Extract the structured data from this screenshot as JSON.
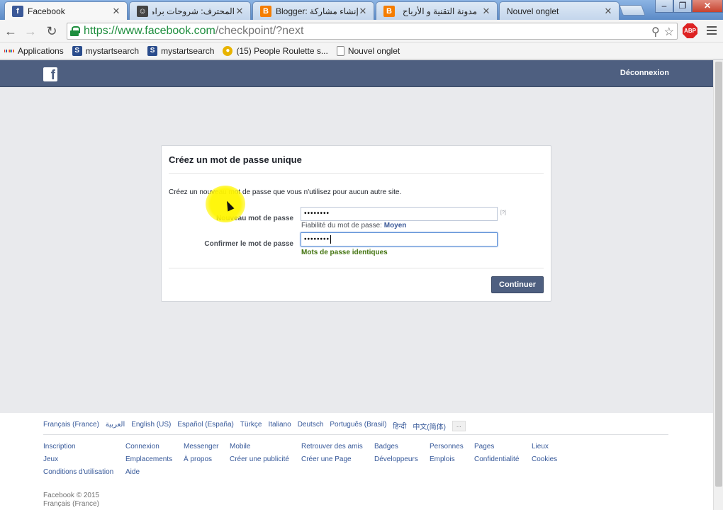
{
  "browser": {
    "tabs": [
      {
        "title": "Facebook",
        "icon": "facebook-icon",
        "color": "#3b5998",
        "active": true
      },
      {
        "title": "المحترف: شروحات برامج",
        "icon": "avatar-icon",
        "color": "#444444",
        "active": false
      },
      {
        "title": "Blogger: إنشاء مشاركة -",
        "icon": "blogger-icon",
        "color": "#f57d00",
        "active": false
      },
      {
        "title": "مدونة التقنية و الأرباح",
        "icon": "blogger-icon",
        "color": "#f57d00",
        "active": false
      },
      {
        "title": "Nouvel onglet",
        "icon": "none",
        "color": "#ffffff",
        "active": false
      }
    ],
    "window_controls": [
      "–",
      "❐",
      "✕"
    ],
    "url": {
      "secure_part": "https://www.facebook.com",
      "rest": "/checkpoint/?next"
    },
    "adblock_label": "ABP",
    "bookmarks": [
      {
        "label": "Applications",
        "icon": "apps-grid-icon"
      },
      {
        "label": "mystartsearch",
        "icon": "mystartsearch-icon"
      },
      {
        "label": "mystartsearch",
        "icon": "mystartsearch-icon"
      },
      {
        "label": "(15) People Roulette s...",
        "icon": "roulette-icon"
      },
      {
        "label": "Nouvel onglet",
        "icon": "page-icon"
      }
    ]
  },
  "header": {
    "logout_label": "Déconnexion"
  },
  "card": {
    "title": "Créez un mot de passe unique",
    "description": "Créez un nouveau mot de passe que vous n'utilisez pour aucun autre site.",
    "new_password_label": "Nouveau mot de passe",
    "new_password_value": "••••••••",
    "help_link": "[?]",
    "strength_prefix": "Fiabilité du mot de passe:",
    "strength_value": "Moyen",
    "confirm_label": "Confirmer le mot de passe",
    "confirm_value": "••••••••",
    "match_text": "Mots de passe identiques",
    "continue_label": "Continuer"
  },
  "footer": {
    "languages": [
      "Français (France)",
      "العربية",
      "English (US)",
      "Español (España)",
      "Türkçe",
      "Italiano",
      "Deutsch",
      "Português (Brasil)",
      "हिन्दी",
      "中文(简体)"
    ],
    "more_languages": "...",
    "links": {
      "col1": [
        "Inscription",
        "Jeux",
        "Conditions d'utilisation"
      ],
      "col2": [
        "Connexion",
        "Emplacements",
        "Aide"
      ],
      "col3": [
        "Messenger",
        "À propos"
      ],
      "col4": [
        "Mobile",
        "Créer une publicité"
      ],
      "col5": [
        "Retrouver des amis",
        "Créer une Page"
      ],
      "col6": [
        "Badges",
        "Développeurs"
      ],
      "col7": [
        "Personnes",
        "Emplois"
      ],
      "col8": [
        "Pages",
        "Confidentialité"
      ],
      "col9": [
        "Lieux",
        "Cookies"
      ]
    },
    "copyright": "Facebook © 2015",
    "locale": "Français (France)"
  }
}
